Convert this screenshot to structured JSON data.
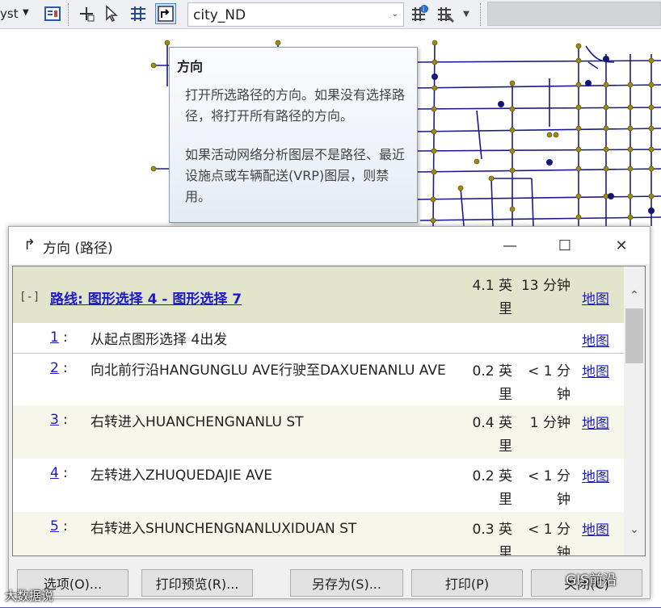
{
  "toolbar": {
    "cut_text": "yst",
    "network_dataset": "city_ND"
  },
  "tooltip": {
    "title": "方向",
    "para1": "打开所选路径的方向。如果没有选择路径，将打开所有路径的方向。",
    "para2": "如果活动网络分析图层不是路径、最近设施点或车辆配送(VRP)图层，则禁用。"
  },
  "window": {
    "title": "方向 (路径)",
    "minimize": "—",
    "maximize": "☐",
    "close": "✕",
    "route": {
      "expand": "[-]",
      "label": "路线: 图形选择 4 - 图形选择 7",
      "distance": "4.1 英里",
      "time": "13 分钟",
      "map": "地图"
    },
    "steps": [
      {
        "num": "1",
        "text": "从起点图形选择 4出发",
        "distance": "",
        "time": "",
        "map": "地图"
      },
      {
        "num": "2",
        "text": "向北前行沿HANGUNGLU AVE行驶至DAXUENANLU AVE",
        "distance": "0.2 英里",
        "time": "< 1 分钟",
        "map": "地图"
      },
      {
        "num": "3",
        "text": "右转进入HUANCHENGNANLU ST",
        "distance": "0.4 英里",
        "time": "1 分钟",
        "map": "地图"
      },
      {
        "num": "4",
        "text": "左转进入ZHUQUEDAJIE AVE",
        "distance": "0.2 英里",
        "time": "< 1 分钟",
        "map": "地图"
      },
      {
        "num": "5",
        "text": "右转进入SHUNCHENGNANLUXIDUAN ST",
        "distance": "0.3 英里",
        "time": "< 1 分钟",
        "map": "地图"
      }
    ],
    "buttons": {
      "options": "选项(O)...",
      "print_preview": "打印预览(R)...",
      "save_as": "另存为(S)...",
      "print": "打印(P)",
      "close": "关闭(C)"
    }
  },
  "watermarks": {
    "left": "大数据说",
    "right": "GIS前沿"
  },
  "colors": {
    "road": "#1a1a8c",
    "node": "#9a8a1a",
    "stop": "#141478",
    "route_header": "#e3e4cc",
    "link": "#1a1acc"
  }
}
